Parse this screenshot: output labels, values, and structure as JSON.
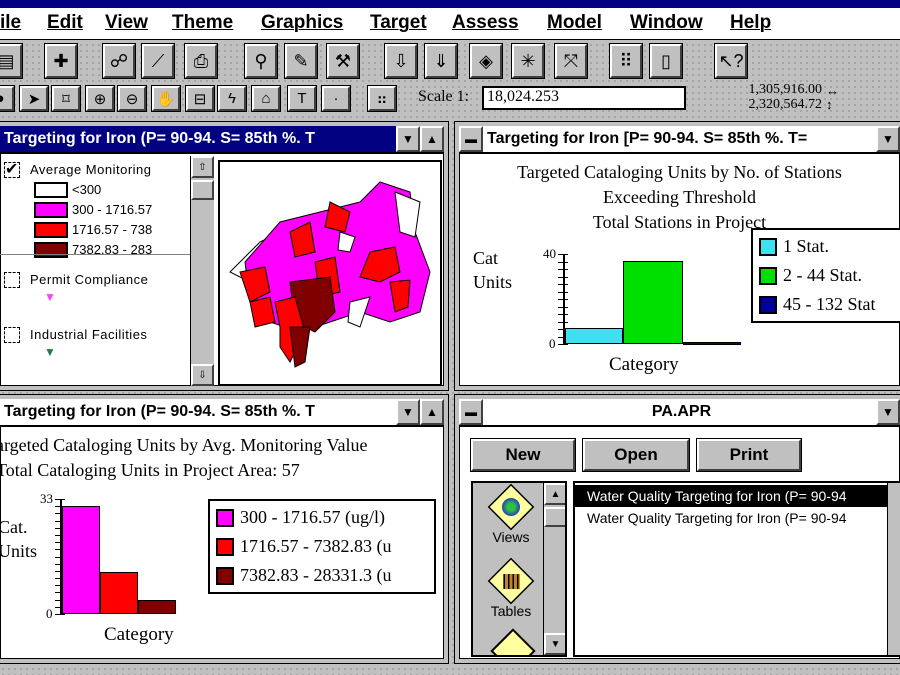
{
  "menu": [
    "ile",
    "Edit",
    "View",
    "Theme",
    "Graphics",
    "Target",
    "Assess",
    "Model",
    "Window",
    "Help"
  ],
  "toolbar1": [
    {
      "icon": "save-icon",
      "g": "▤"
    },
    {
      "icon": "add-theme-icon",
      "g": "✚"
    },
    {
      "icon": "theme-properties-icon",
      "g": "☍"
    },
    {
      "icon": "edit-legend-icon",
      "g": "⟋"
    },
    {
      "icon": "print-icon",
      "g": "⎙"
    },
    {
      "icon": "find-icon",
      "g": "⚲"
    },
    {
      "icon": "query-icon",
      "g": "✎"
    },
    {
      "icon": "tools-icon",
      "g": "⚒"
    },
    {
      "icon": "select-theme-icon",
      "g": "⇩"
    },
    {
      "icon": "load-theme-icon",
      "g": "⇓"
    },
    {
      "icon": "zoom-active-icon",
      "g": "◈"
    },
    {
      "icon": "zoom-in-full-icon",
      "g": "✳"
    },
    {
      "icon": "zoom-out-full-icon",
      "g": "⤧"
    },
    {
      "icon": "layout-icon",
      "g": "⠿"
    },
    {
      "icon": "page-icon",
      "g": "▯"
    },
    {
      "icon": "help-pointer-icon",
      "g": "↖?"
    }
  ],
  "toolbar2": [
    {
      "icon": "identify-icon",
      "g": "●"
    },
    {
      "icon": "pointer-icon",
      "g": "➤"
    },
    {
      "icon": "vertex-edit-icon",
      "g": "⌑"
    },
    {
      "icon": "zoom-in-icon",
      "g": "⊕"
    },
    {
      "icon": "zoom-out-icon",
      "g": "⊖"
    },
    {
      "icon": "pan-icon",
      "g": "✋"
    },
    {
      "icon": "measure-icon",
      "g": "⊟"
    },
    {
      "icon": "hotlink-icon",
      "g": "ϟ"
    },
    {
      "icon": "label-icon",
      "g": "⌂"
    },
    {
      "icon": "text-icon",
      "g": "T"
    },
    {
      "icon": "draw-point-icon",
      "g": "·"
    },
    {
      "icon": "snap-icon",
      "g": "⠶"
    }
  ],
  "scale": {
    "label": "Scale 1:",
    "value": "18,024.253"
  },
  "coords": {
    "x": "1,305,916.00",
    "y": "2,320,564.72"
  },
  "colors": {
    "active_title": "#000080",
    "magenta": "#ff00ff",
    "red": "#ff0000",
    "dark_red": "#800000",
    "cyan": "#40e0f0",
    "green": "#00e000",
    "blue": "#0000a0"
  },
  "view_window": {
    "title": "Targeting for Iron (P= 90-94. S= 85th %. T",
    "themes": [
      {
        "name": "Average Monitoring",
        "checked": true,
        "classes": [
          {
            "label": "<300",
            "color": "#ffffff"
          },
          {
            "label": "300 - 1716.57",
            "color": "#ff00ff"
          },
          {
            "label": "1716.57 - 738",
            "color": "#ff0000"
          },
          {
            "label": "7382.83 - 283",
            "color": "#800000"
          }
        ]
      },
      {
        "name": "Permit Compliance",
        "checked": false,
        "symbol_color": "#ff40ff"
      },
      {
        "name": "Industrial Facilities",
        "checked": false,
        "symbol_color": "#208040"
      }
    ]
  },
  "chart1_window": {
    "title": "Targeting for Iron [P= 90-94. S= 85th %. T="
  },
  "chart2_window": {
    "title": "Targeting for Iron (P= 90-94. S= 85th %. T"
  },
  "chart_data": [
    {
      "type": "bar",
      "title": [
        "Targeted Cataloging Units by No. of Stations",
        "Exceeding Threshold",
        "Total Stations in Project"
      ],
      "xlabel": "Category",
      "ylabel": [
        "Cat",
        "Units"
      ],
      "ylim": [
        0,
        40
      ],
      "legend": "right",
      "series": [
        {
          "name": "1 Stat.",
          "values": [
            7
          ],
          "color": "#40e0f0"
        },
        {
          "name": "2 - 44 Stat.",
          "values": [
            37
          ],
          "color": "#00e000"
        },
        {
          "name": "45 - 132 Stat",
          "values": [
            1
          ],
          "color": "#0000a0"
        }
      ]
    },
    {
      "type": "bar",
      "title": [
        "argeted Cataloging Units by Avg. Monitoring Value",
        "Total Cataloging Units in Project Area: 57"
      ],
      "xlabel": "Category",
      "ylabel": [
        "Cat.",
        "Units"
      ],
      "ylim": [
        0,
        33
      ],
      "legend": "right",
      "series": [
        {
          "name": "300 - 1716.57 (ug/l)",
          "values": [
            31
          ],
          "color": "#ff00ff"
        },
        {
          "name": "1716.57 - 7382.83 (u",
          "values": [
            12
          ],
          "color": "#ff0000"
        },
        {
          "name": "7382.83 - 28331.3 (u",
          "values": [
            4
          ],
          "color": "#800000"
        }
      ]
    }
  ],
  "project_window": {
    "title": "PA.APR",
    "buttons": [
      "New",
      "Open",
      "Print"
    ],
    "doc_types": [
      "Views",
      "Tables"
    ],
    "items": [
      "Water Quality Targeting for Iron (P= 90-94",
      "Water Quality Targeting for Iron (P= 90-94"
    ],
    "selected_index": 0
  }
}
